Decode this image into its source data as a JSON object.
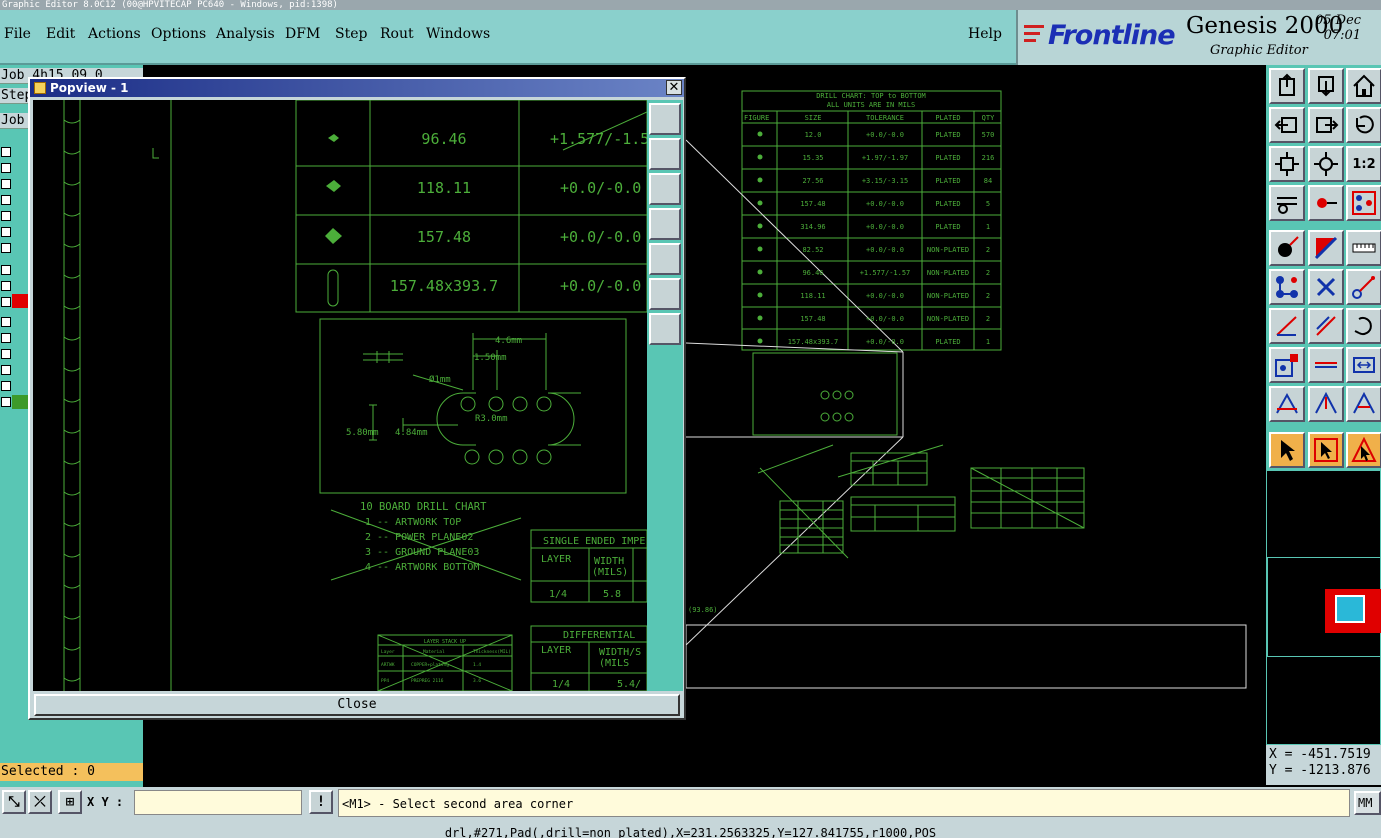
{
  "window": {
    "title": "Graphic Editor 8.0C12 (00@HPVITECAP PC640 - Windows, pid:1398)"
  },
  "menu": {
    "items": [
      "File",
      "Edit",
      "Actions",
      "Options",
      "Analysis",
      "DFM",
      "Step",
      "Rout",
      "Windows"
    ],
    "help": "Help"
  },
  "logo": {
    "brand": "Frontline",
    "product": "Genesis 2000",
    "subtitle": "Graphic Editor",
    "date": "05 Dec",
    "time": "07:01"
  },
  "left_panel": {
    "job_value": "Job   4h15 09   0",
    "step_label": "Step",
    "job_label": "Job",
    "selected": "Selected : 0"
  },
  "popview": {
    "title": "Popview - 1",
    "close_label": "Close",
    "drill_rows": [
      {
        "size": "96.46",
        "tol": "+1.577/-1.5"
      },
      {
        "size": "118.11",
        "tol": "+0.0/-0.0"
      },
      {
        "size": "157.48",
        "tol": "+0.0/-0.0"
      },
      {
        "size": "157.48x393.7",
        "tol": "+0.0/-0.0"
      }
    ],
    "detail": {
      "dim_a": "4.6mm",
      "dim_b": "1.50mm",
      "dim_c": "Ø1mm",
      "dim_d": "5.80mm",
      "dim_e": "4.84mm",
      "dim_f": "R3.0mm"
    },
    "board_chart": {
      "title": "10 BOARD DRILL CHART",
      "lines": [
        "1 -- ARTWORK TOP",
        "2 -- POWER PLANE02",
        "3 -- GROUND PLANE03",
        "4 -- ARTWORK BOTTOM"
      ]
    },
    "single_ended": {
      "title": "SINGLE ENDED IMPE",
      "col_layer": "LAYER",
      "col_width": "WIDTH",
      "col_width_unit": "(MILS)",
      "row_layer": "1/4",
      "row_width": "5.8"
    },
    "differential": {
      "title": "DIFFERENTIAL",
      "col_layer": "LAYER",
      "col_width": "WIDTH/S",
      "col_width_unit": "(MILS",
      "row_layer": "1/4",
      "row_width": "5.4/"
    },
    "stackup": {
      "title": "LAYER STACK UP",
      "col1": "Layer",
      "col2": "Material",
      "col3": "Thickness(MIL)",
      "row1": [
        "ARTWK",
        "COPPER+plating",
        "1.4"
      ],
      "row2": [
        "PP4",
        "PREPREG 2116",
        "3.6"
      ]
    }
  },
  "main": {
    "drill_chart": {
      "title": "DRILL CHART: TOP to BOTTOM",
      "subtitle": "ALL UNITS ARE IN MILS",
      "headers": [
        "FIGURE",
        "SIZE",
        "TOLERANCE",
        "PLATED",
        "QTY"
      ],
      "rows": [
        [
          "12.0",
          "+0.0/-0.0",
          "PLATED",
          "570"
        ],
        [
          "15.35",
          "+1.97/-1.97",
          "PLATED",
          "216"
        ],
        [
          "27.56",
          "+3.15/-3.15",
          "PLATED",
          "84"
        ],
        [
          "157.48",
          "+0.0/-0.0",
          "PLATED",
          "5"
        ],
        [
          "314.96",
          "+0.0/-0.0",
          "PLATED",
          "1"
        ],
        [
          "82.52",
          "+0.0/-0.0",
          "NON-PLATED",
          "2"
        ],
        [
          "96.46",
          "+1.577/-1.57",
          "NON-PLATED",
          "2"
        ],
        [
          "118.11",
          "+0.0/-0.0",
          "NON-PLATED",
          "2"
        ],
        [
          "157.48",
          "+0.0/-0.0",
          "NON-PLATED",
          "2"
        ],
        [
          "157.48x393.7",
          "+0.0/-0.0",
          "PLATED",
          "1"
        ]
      ]
    },
    "coord_label": "(93.86)"
  },
  "command": {
    "xy_label": "X Y :",
    "xy_value": "",
    "exclaim": "!",
    "prompt": "<M1> - Select second area corner",
    "units": "MM"
  },
  "coords": {
    "x": "X = -451.7519",
    "y": "Y = -1213.876"
  },
  "status": "drl,#271,Pad(,drill=non_plated),X=231.2563325,Y=127.841755,r1000,POS",
  "colors": {
    "cad_line": "#4cae3a",
    "menu_bg": "#8ad0cc",
    "panel": "#59c6b4"
  }
}
